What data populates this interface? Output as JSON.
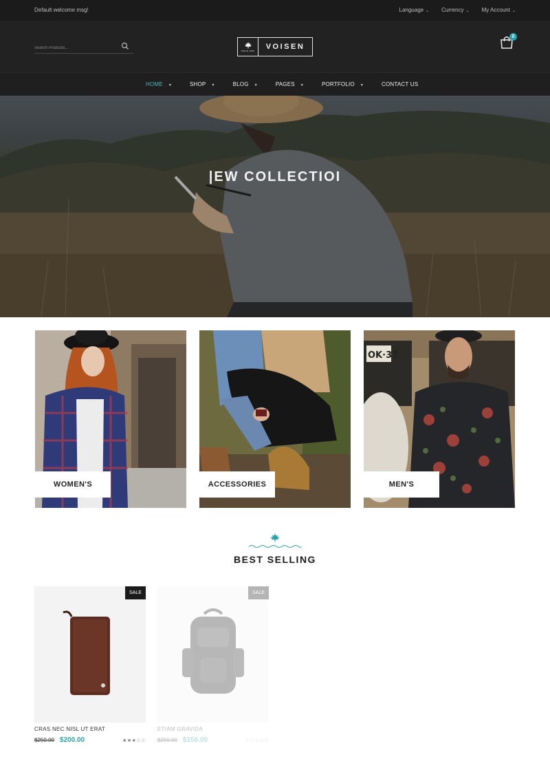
{
  "topbar": {
    "welcome": "Default welcome msg!",
    "language": "Language",
    "currency": "Currency",
    "account": "My Account"
  },
  "header": {
    "search_placeholder": "Search Products...",
    "logo_name": "VOISEN",
    "logo_since": "SINCE 1990",
    "cart_count": "0"
  },
  "nav": {
    "items": [
      {
        "label": "HOME"
      },
      {
        "label": "SHOP"
      },
      {
        "label": "BLOG"
      },
      {
        "label": "PAGES"
      },
      {
        "label": "PORTFOLIO"
      },
      {
        "label": "CONTACT US"
      }
    ]
  },
  "hero": {
    "title": "|EW COLLECTIOI"
  },
  "categories": [
    {
      "label": "WOMEN'S"
    },
    {
      "label": "ACCESSORIES"
    },
    {
      "label": "MEN'S"
    }
  ],
  "section": {
    "title": "BEST SELLING"
  },
  "products": [
    {
      "name": "CRAS NEC NISL UT ERAT",
      "old_price": "$250.00",
      "price": "$200.00",
      "badge": "SALE",
      "rating": 3
    },
    {
      "name": "ETIAM GRAVIDA",
      "old_price": "$250.00",
      "price": "$150.00",
      "badge": "SALE",
      "rating": 0
    }
  ],
  "colors": {
    "accent": "#2aa3ad",
    "dark": "#1b1b1b"
  }
}
